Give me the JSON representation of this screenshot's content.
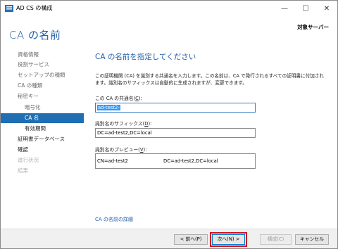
{
  "window": {
    "title": "AD CS の構成"
  },
  "header": {
    "page_title": "CA の名前",
    "target_server": "対象サーバー"
  },
  "sidebar": {
    "items": [
      {
        "label": "資格情報",
        "state": "normal"
      },
      {
        "label": "役割サービス",
        "state": "normal"
      },
      {
        "label": "セットアップの種類",
        "state": "normal"
      },
      {
        "label": "CA の種類",
        "state": "normal"
      },
      {
        "label": "秘密キー",
        "state": "normal"
      },
      {
        "label": "暗号化",
        "state": "sub"
      },
      {
        "label": "CA 名",
        "state": "active"
      },
      {
        "label": "有効期間",
        "state": "sub-dark"
      },
      {
        "label": "証明書データベース",
        "state": "dark"
      },
      {
        "label": "確認",
        "state": "dark"
      },
      {
        "label": "進行状況",
        "state": "disabled"
      },
      {
        "label": "結果",
        "state": "disabled"
      }
    ]
  },
  "main": {
    "heading": "CA の名前を指定してください",
    "description": "この証明機関 (CA) を識別する共通名を入力します。この名前は、CA で発行されるすべての証明書に付加されます。識別名のサフィックスは自動的に生成されますが、変更できます。",
    "common_name": {
      "label": "この CA の共通名(",
      "access_key": "C",
      "label_end": "):",
      "value": "ad-test2-"
    },
    "dn_suffix": {
      "label": "識別名のサフィックス(",
      "access_key": "D",
      "label_end": "):",
      "value": "DC=ad-test2,DC=local"
    },
    "preview": {
      "label": "識別名のプレビュー(",
      "access_key": "V",
      "label_end": "):",
      "value_start": "CN=ad-test2",
      "value_end": "DC=ad-test2,DC=local"
    },
    "more_link": "CA の名前の詳細"
  },
  "footer": {
    "back": "< 前へ(P)",
    "next": "次へ(N) >",
    "configure": "構成(C)",
    "cancel": "キャンセル"
  },
  "colors": {
    "accent": "#1f6fb2",
    "title_blue": "#1f5fa8",
    "highlight": "#d0121b"
  }
}
